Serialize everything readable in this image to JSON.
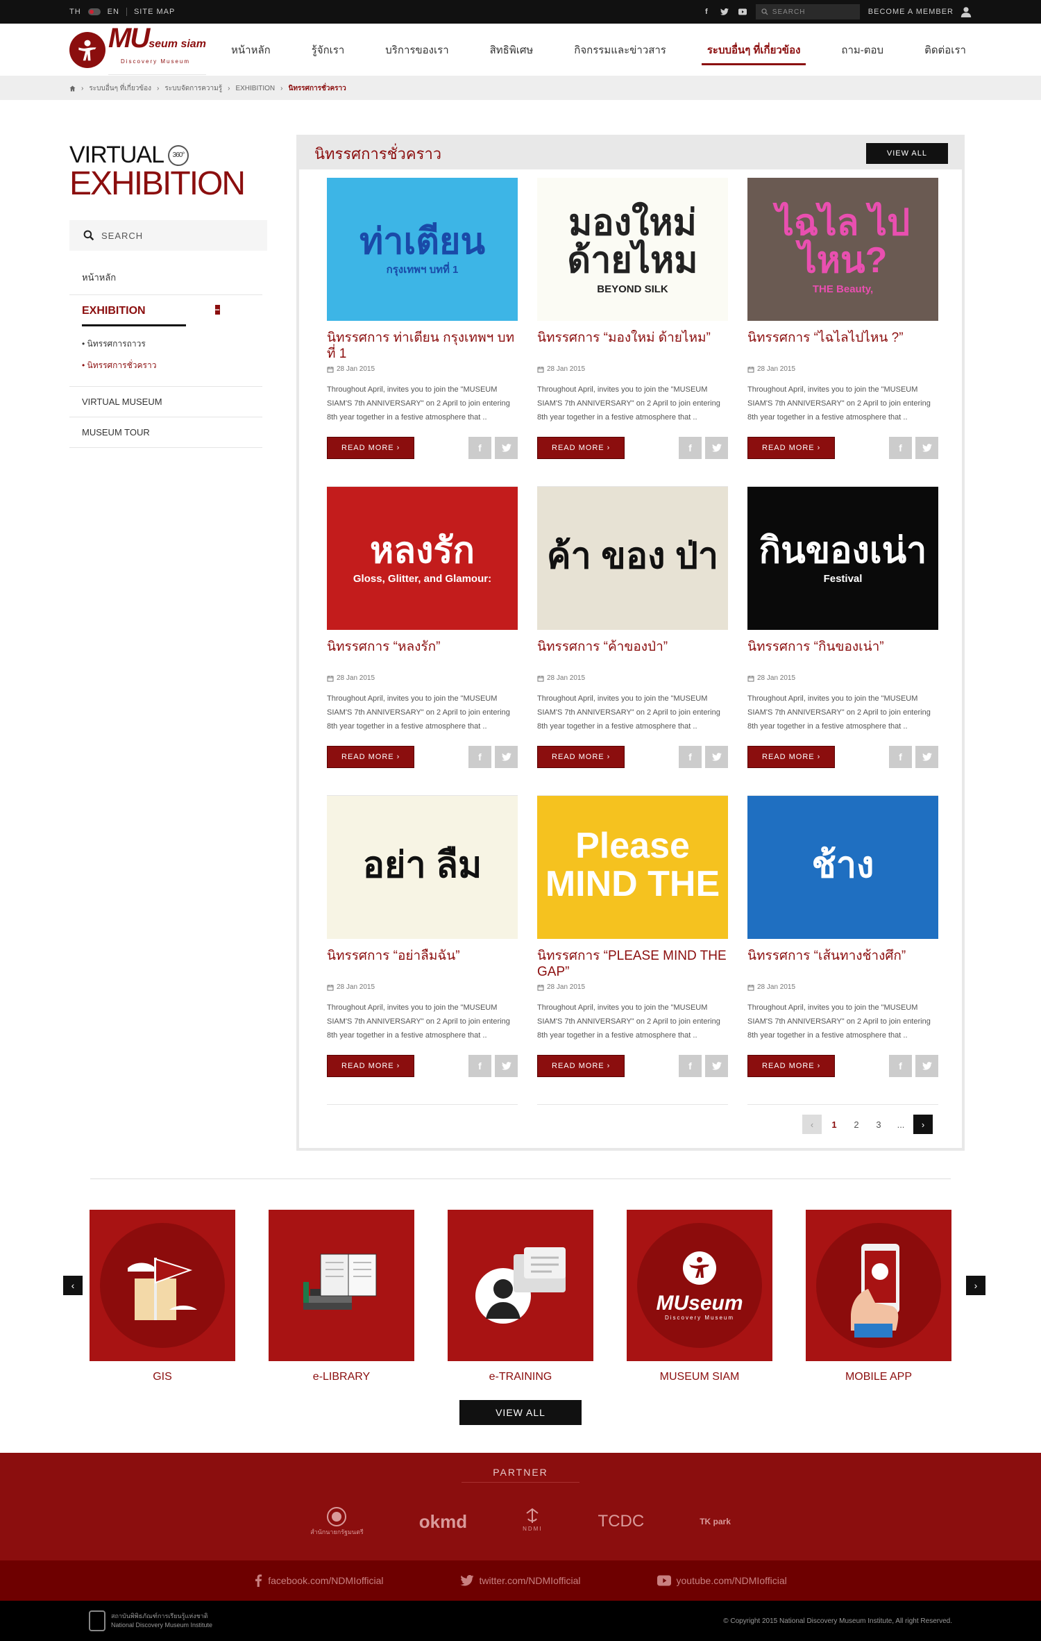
{
  "topbar": {
    "lang_th": "TH",
    "lang_en": "EN",
    "sitemap": "SITE MAP",
    "search_placeholder": "SEARCH",
    "member": "BECOME A MEMBER"
  },
  "logo": {
    "big": "MU",
    "small": "seum siam",
    "sub": "Discovery Museum"
  },
  "nav": [
    "หน้าหลัก",
    "รู้จักเรา",
    "บริการของเรา",
    "สิทธิพิเศษ",
    "กิจกรรมและข่าวสาร",
    "ระบบอื่นๆ ที่เกี่ยวข้อง",
    "ถาม-ตอบ",
    "ติดต่อเรา"
  ],
  "breadcrumb": [
    "ระบบอื่นๆ ที่เกี่ยวข้อง",
    "ระบบจัดการความรู้",
    "EXHIBITION",
    "นิทรรศการชั่วคราว"
  ],
  "sidebar": {
    "virtual": "VIRTUAL",
    "deg": "360°",
    "exhibition": "EXHIBITION",
    "search": "SEARCH",
    "home": "หน้าหลัก",
    "active": "EXHIBITION",
    "sub": [
      "นิทรรศการถาวร",
      "นิทรรศการชั่วคราว"
    ],
    "virtual_museum": "VIRTUAL MUSEUM",
    "museum_tour": "MUSEUM TOUR"
  },
  "content": {
    "title": "นิทรรศการชั่วคราว",
    "view_all": "VIEW ALL",
    "read_more": "READ MORE",
    "date": "28 Jan 2015",
    "desc": "Throughout April, invites you to join the \"MUSEUM SIAM'S 7th ANNIVERSARY\" on 2 April to join entering 8th year together in a festive atmosphere that ..",
    "cards": [
      {
        "title": "นิทรรศการ ท่าเตียน กรุงเทพฯ บทที่ 1",
        "thumb_text": "ท่าเตียน",
        "thumb_sub": "กรุงเทพฯ บทที่ 1",
        "bg": "#3db5e6",
        "fg": "#1a4aa8"
      },
      {
        "title": "นิทรรศการ “มองใหม่ ด้ายไหม”",
        "thumb_text": "มองใหม่ ด้ายไหม",
        "thumb_sub": "BEYOND SILK",
        "bg": "#fbfbf4",
        "fg": "#222"
      },
      {
        "title": "นิทรรศการ “ไฉไลไปไหน ?”",
        "thumb_text": "ไฉไล ไปไหน?",
        "thumb_sub": "THE Beauty,",
        "bg": "#6a5a52",
        "fg": "#e94fb0"
      },
      {
        "title": "นิทรรศการ “หลงรัก”",
        "thumb_text": "หลงรัก",
        "thumb_sub": "Gloss, Glitter, and Glamour:",
        "bg": "#c31c1c",
        "fg": "#fff"
      },
      {
        "title": "นิทรรศการ “ค้าของป่า”",
        "thumb_text": "ค้า ของ ป่า",
        "thumb_sub": "",
        "bg": "#e7e2d4",
        "fg": "#111"
      },
      {
        "title": "นิทรรศการ “กินของเน่า”",
        "thumb_text": "กินของเน่า",
        "thumb_sub": "Festival",
        "bg": "#0a0a0a",
        "fg": "#fff"
      },
      {
        "title": "นิทรรศการ “อย่าลืมฉัน”",
        "thumb_text": "อย่า ลืม",
        "thumb_sub": "",
        "bg": "#f7f4e4",
        "fg": "#111"
      },
      {
        "title": "นิทรรศการ “PLEASE MIND THE GAP”",
        "thumb_text": "Please MIND THE",
        "thumb_sub": "",
        "bg": "#f5c21f",
        "fg": "#fff"
      },
      {
        "title": "นิทรรศการ “เส้นทางช้างศึก”",
        "thumb_text": "ช้าง",
        "thumb_sub": "",
        "bg": "#1f6fc1",
        "fg": "#fff"
      }
    ],
    "pages": [
      "1",
      "2",
      "3",
      "..."
    ]
  },
  "services": [
    {
      "label": "GIS",
      "icon": "flag-icon"
    },
    {
      "label": "e-LIBRARY",
      "icon": "book-icon"
    },
    {
      "label": "e-TRAINING",
      "icon": "chat-icon"
    },
    {
      "label": "MUSEUM SIAM",
      "icon": "museum-logo-icon"
    },
    {
      "label": "MOBILE APP",
      "icon": "phone-icon"
    }
  ],
  "view_all_services": "VIEW ALL",
  "partner": {
    "title": "PARTNER",
    "logos": [
      "สำนักนายกรัฐมนตรี",
      "okmd",
      "NDMI",
      "TCDC",
      "TK park"
    ]
  },
  "social": {
    "facebook": "facebook.com/NDMIofficial",
    "twitter": "twitter.com/NDMIofficial",
    "youtube": "youtube.com/NDMIofficial"
  },
  "footer": {
    "org_th": "สถาบันพิพิธภัณฑ์การเรียนรู้แห่งชาติ",
    "org_en": "National Discovery Museum Institute",
    "copyright": "© Copyright 2015 National Discovery Museum Institute, All right Reserved."
  }
}
